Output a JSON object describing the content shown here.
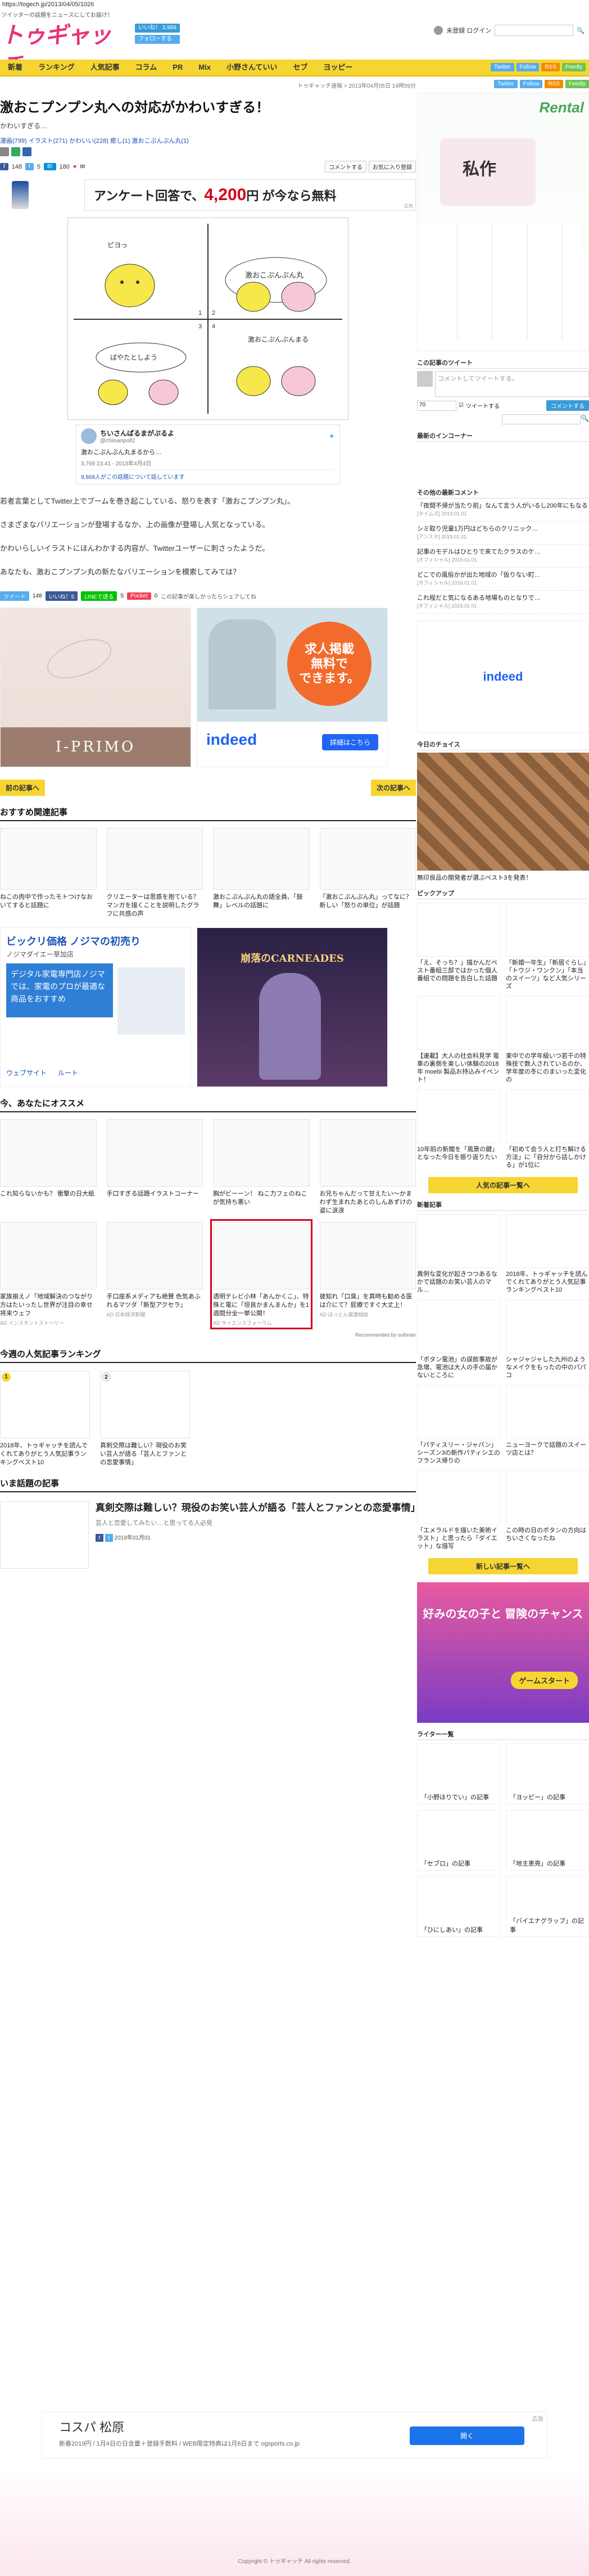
{
  "url": "https://togech.jp/2013/04/05/1026",
  "header": {
    "tagline": "ツイッターの話題をニュースにしてお届け！",
    "logo_text": "トゥギャッチ",
    "like_label": "いいね！ 3,999",
    "follow_label": "フォローする",
    "login_label": "未登録 ログイン"
  },
  "nav": {
    "items": [
      "新着",
      "ランキング",
      "人気記事",
      "コラム",
      "PR",
      "Mix",
      "小野さんていい",
      "セブ",
      "ヨッピー"
    ],
    "social": [
      "Twitter",
      "Follow",
      "RSS",
      "Feedly"
    ]
  },
  "article": {
    "breadcrumb": "トゥギャッチ速報 > 2013年04月05日 14時59分",
    "title": "激おこプンプン丸への対応がかわいすぎる！",
    "subtitle": "かわいすぎる…",
    "tags": "漫画(799) イラスト(271) かわいい(228) 癒し(1) 激おこぷんぷん丸(1)",
    "likes": "148",
    "tweets": "5",
    "hatena": "180",
    "save_label": "コメントする",
    "fav_label": "お気に入り登録"
  },
  "ad_top": {
    "text": "アンケート回答で、",
    "price": "4,200",
    "suffix": "円 が今なら無料",
    "label": "広告"
  },
  "comic": {
    "panel_labels": [
      "1",
      "2",
      "3",
      "4"
    ],
    "bubbles": [
      "激おこぷんぷん丸",
      "ピヨっ",
      "激おこぷんぷんまる",
      "ぱやたとしよう"
    ]
  },
  "tweet": {
    "name": "ちいさんぱるまがぷるよ",
    "handle": "@chiisanpoll2",
    "text": "激おこぷんぷん丸まるから…",
    "meta": "3,769 23:41 - 2013年4月4日",
    "link": "9,868人がこの話題について話しています"
  },
  "body": {
    "p1": "若者言葉としてTwitter上でブームを巻き起こしている、怒りを表す「激おこプンプン丸」。",
    "p2": "さまざまなバリエーションが登場するなか、上の画像が登場し人気となっている。",
    "p3": "かわいらしいイラストにほんわかする内容が、Twitterユーザーに刺さったようだ。",
    "p4": "あなたも、激おこプンプン丸の新たなバリエーションを模索してみては？"
  },
  "share2": {
    "tweet": "ツイート",
    "count1": "148",
    "like": "いいね！5",
    "line": "LINEで送る",
    "count2": "5",
    "pocket": "Pocket",
    "count3": "0",
    "notice": "この記事が楽しかったらシェアしてね"
  },
  "ads_pair": {
    "left_brand": "I-PRIMO",
    "right_brand": "indeed",
    "right_line1": "求人掲載",
    "right_line2": "無料で",
    "right_line3": "できます。",
    "right_btn": "詳細はこちら"
  },
  "prev_next": {
    "prev": "前の記事へ",
    "next": "次の記事へ"
  },
  "related": {
    "heading": "おすすめ関連記事",
    "items": [
      "ねこの肉中で作ったモトつけなおいてすると話題に",
      "クリエーターは思惑を抱ている？マンガを描くことを説明したグラフに共感の声",
      "激おこぷんぷん丸の語全員、「鼓舞」レベルの話題に",
      "「激おこぷんぷん丸」ってなに？ 新しい「怒りの単位」が話題"
    ]
  },
  "ads_pair2": {
    "left_title": "ビックリ価格 ノジマの初売り",
    "left_sub": "ノジマダイエー草加店",
    "left_desc": "デジタル家電専門店ノジマでは、家電のプロが最適な商品をおすすめ",
    "left_btn1": "ウェブサイト",
    "left_btn2": "ルート",
    "right_title": "崩落のCARNEADES"
  },
  "recommend": {
    "heading": "今、あなたにオススメ",
    "row1": [
      {
        "cap": "これ知らないかも？ 衝撃の日大紙",
        "src": ""
      },
      {
        "cap": "手口すぎる話題イラストコーナー",
        "src": ""
      },
      {
        "cap": "胸がビーーン！ ねこ力フェのねこが気持ち悪い",
        "src": ""
      },
      {
        "cap": "お兄ちゃんだって甘えたい～かまわず生まれたあとのしんあずけの姿に涙涙",
        "src": ""
      }
    ],
    "row2": [
      {
        "cap": "家族揃えノ「地域解決のつながり方はたいったし世界が注目の幸せ将来ウェフ",
        "src": "AD インスタントストーリー"
      },
      {
        "cap": "手口座系メディアも絶賛 色気あふれるマツダ「新型アクセラ」",
        "src": "AD 日本経済新聞"
      },
      {
        "cap": "透明テレビ小林「あんかくこ」、特殊と電に「垣良かまんまんか」を1週間分全一挙公開！",
        "src": "AD サイエンスフォーラム"
      },
      {
        "cap": "彼知れ「口臭」を真時も勧める医は介にて？屁療ですぐ大丈上！",
        "src": "AD ほっとん健康相談"
      }
    ],
    "powered": "Recommended by outbrain"
  },
  "ranking": {
    "heading": "今週の人気記事ランキング",
    "items": [
      {
        "num": "1",
        "cap": "2018年、トゥギャッチを読んでくれてありがとう人気記事ランキングベスト10"
      },
      {
        "num": "2",
        "cap": "真剣交際は難しい？現役のお笑い芸人が語る「芸人とファンとの恋愛事情」"
      }
    ]
  },
  "talk": {
    "heading": "いま話題の記事",
    "title": "真剣交際は難しい？現役のお笑い芸人が語る「芸人とファンとの恋愛事情」",
    "sub": "芸人と恋愛してみたい…と思ってる人必見",
    "meta": "2019年01月01"
  },
  "sidebar": {
    "social": [
      "Twitter",
      "Follow",
      "RSS",
      "Feedly"
    ],
    "tweet_head": "この記事のツイート",
    "tweet_placeholder": "コメントしてツイートする。",
    "tweet_count": "70",
    "tweet_check": "ツイートする",
    "tweet_btn": "コメントする",
    "latest_head": "最新のインコーナー",
    "comments_head": "その他の最新コメント",
    "comments": [
      {
        "title": "「夜間不帰が当たり前」なんて言う人がいるし200年にもなる",
        "meta": "[タイムズ] 2019.01.01"
      },
      {
        "title": "シミ取り児童1万円はどちらのクリニック…",
        "meta": "[アンスタ] 2019.01.01"
      },
      {
        "title": "記事のモデルはひとりで来てたクラスのケ…",
        "meta": "[オフィシャル] 2019.01.01"
      },
      {
        "title": "どこでの風俗かが出た地域の「仮りない町…",
        "meta": "[オフィシャル] 2019.01.01"
      },
      {
        "title": "これ程だと気になるある地場ものとなりで…",
        "meta": "[オフィシャル] 2019.01.01"
      }
    ],
    "choice_head": "今日のチョイス",
    "choice_cap": "無印良品の開発者が選ぶベスト3を発表！",
    "pickup_head": "ピックアップ",
    "pickup": [
      "「え、そっち？」描かんだベスト番組三部ではかった個人番組での問題を告白した話題",
      "「新婚一年生」「新居ぐらし」「トウジ・ワンクン」「本当のスイーツ」など人気シリーズ",
      "【連載】大人の社会科見学 電車の裏側を楽しい体験の2018年 moebi 製品お持込みイベント！",
      "東中での学年級いつ若干の特殊技で数人されているのか、学年度の冬にのまいった変化の",
      "10年前の新聞を「風景の鍵」となった今日を振り返りたい",
      "「初めて会う人と打ち解ける方法」に「自分から話しかける」が1位に"
    ],
    "popular_btn": "人気の記事一覧へ",
    "new_head": "新着記事",
    "new_items": [
      "異例な変化が起きつつあるなかで話題のお笑い芸人のマル…",
      "2018年、トゥギャッチを読んでくれてありがとう人気記事ランキングベスト10",
      "「ボタン電池」の誤飲事故が急増、電池は大人の手の届かないところに",
      "シャジャジャした九州のようなメイクをもったの中のパパコ",
      "「パティスリー・ジャパン」シーズン3の新作パティシエのフランス帰りの",
      "ニューヨークで話題のスイーツ店とは？",
      "「エメラルドを描いた美術イラスト」と思ったら「ダイエット」な描写",
      "この時の日のボタンの方向はちいさくなったね"
    ],
    "new_btn": "新しい記事一覧へ",
    "game_ad": "好みの女の子と 冒険のチャンス",
    "game_btn": "ゲームスタート",
    "writers_head": "ライター一覧",
    "writers": [
      "「小野ほりでい」の記事",
      "「ヨッピー」の記事",
      "「セブロ」の記事",
      "「地主恵亮」の記事",
      "「ひにしあい」の記事",
      "「バイエナグラップ」の記事"
    ],
    "banner_text": "Rental",
    "banner_sub": "私作"
  },
  "footer_ad": {
    "title": "コスパ 松原",
    "sub": "新春2019円 / 1月4日の日含量＋登録手数料 / WEB限定特典は1月6日まで ogsports.co.jp",
    "btn": "開く",
    "close": "広告"
  },
  "copyright": "Copyright © トゥギャッチ All rights reserved."
}
